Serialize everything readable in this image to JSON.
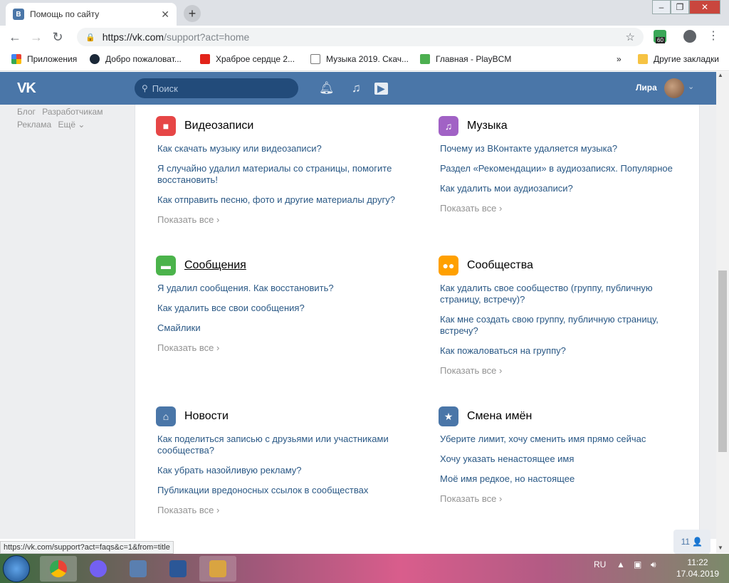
{
  "browser": {
    "tab_title": "Помощь по сайту",
    "tab_close": "✕",
    "new_tab": "+",
    "win_min": "–",
    "win_max": "❐",
    "win_close": "✕",
    "url_host": "https://vk.com",
    "url_rest": "/support?act=home",
    "extension_badge": "60"
  },
  "bookmarks": {
    "apps": "Приложения",
    "items": [
      {
        "label": "Добро пожаловат...",
        "color": "#1b2838"
      },
      {
        "label": "Храброе сердце 2...",
        "color": "#e2231a"
      },
      {
        "label": "Музыка 2019. Скач...",
        "color": "#ffffff"
      },
      {
        "label": "Главная - PlayBCM",
        "color": "#4caf50"
      }
    ],
    "more": "»",
    "other": "Другие закладки"
  },
  "vk": {
    "logo": "VK",
    "search_placeholder": "Поиск",
    "user_name": "Лира",
    "left_links": [
      "Блог",
      "Разработчикам",
      "Реклама",
      "Ещё ⌄"
    ]
  },
  "sections": [
    {
      "title": "Видеозаписи",
      "icon": "video-icon",
      "glyph": "▶",
      "color": "#e64646",
      "questions": [
        "Как скачать музыку или видеозаписи?",
        "Я случайно удалил материалы со страницы, помогите восстановить!",
        "Как отправить песню, фото и другие материалы другу?"
      ]
    },
    {
      "title": "Музыка",
      "icon": "music-icon",
      "glyph": "♫",
      "color": "#a162c5",
      "questions": [
        "Почему из ВКонтакте удаляется музыка?",
        "Раздел «Рекомендации» в аудиозаписях. Популярное",
        "Как удалить мои аудиозаписи?"
      ]
    },
    {
      "title": "Сообщения",
      "icon": "message-icon",
      "glyph": "✉",
      "color": "#4bb34b",
      "questions": [
        "Я удалил сообщения. Как восстановить?",
        "Как удалить все свои сообщения?",
        "Смайлики"
      ]
    },
    {
      "title": "Сообщества",
      "icon": "community-icon",
      "glyph": "👥",
      "color": "#ffa000",
      "questions": [
        "Как удалить свое сообщество (группу, публичную страницу, встречу)?",
        "Как мне создать свою группу, публичную страницу, встречу?",
        "Как пожаловаться на группу?"
      ]
    },
    {
      "title": "Новости",
      "icon": "home-icon",
      "glyph": "⌂",
      "color": "#4a76a8",
      "questions": [
        "Как поделиться записью с друзьями или участниками сообщества?",
        "Как убрать назойливую рекламу?",
        "Публикации вредоносных ссылок в сообществах"
      ]
    },
    {
      "title": "Смена имён",
      "icon": "star-icon",
      "glyph": "★",
      "color": "#4a76a8",
      "questions": [
        "Уберите лимит, хочу сменить имя прямо сейчас",
        "Хочу указать ненастоящее имя",
        "Моё имя редкое, но настоящее"
      ]
    }
  ],
  "show_all": "Показать все ›",
  "chat_count": "11 👤",
  "status_url": "https://vk.com/support?act=faqs&c=1&from=title",
  "taskbar": {
    "lang": "RU",
    "time": "11:22",
    "date": "17.04.2019"
  }
}
